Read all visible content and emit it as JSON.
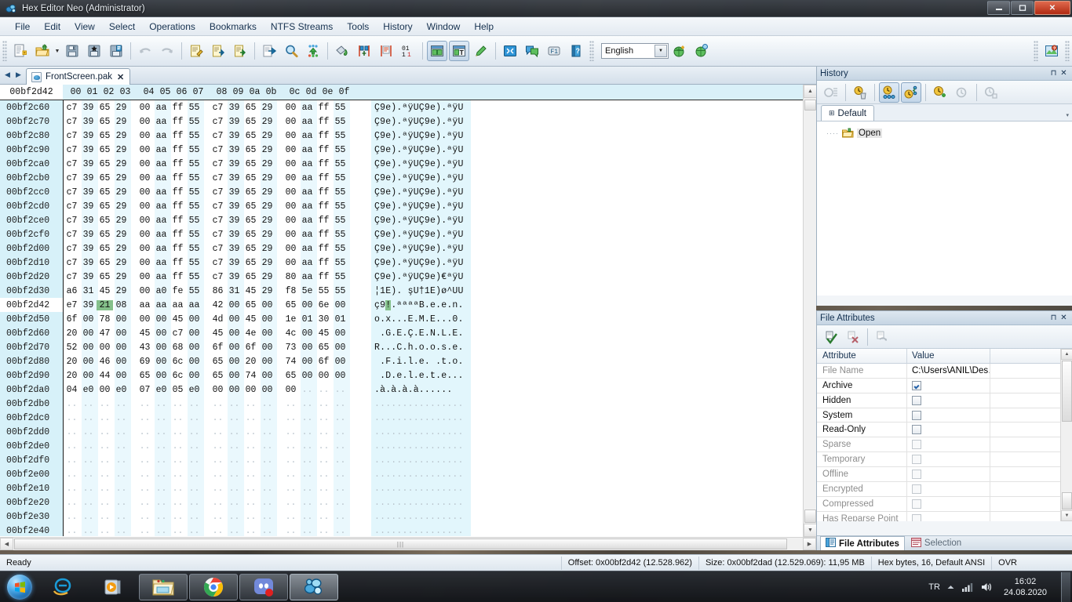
{
  "window": {
    "title": "Hex Editor Neo (Administrator)",
    "icon": "app-icon",
    "buttons": {
      "minimize": "—",
      "maximize": "❐",
      "close": "✕"
    }
  },
  "menubar": {
    "items": [
      {
        "label": "File"
      },
      {
        "label": "Edit"
      },
      {
        "label": "View"
      },
      {
        "label": "Select"
      },
      {
        "label": "Operations"
      },
      {
        "label": "Bookmarks"
      },
      {
        "label": "NTFS Streams"
      },
      {
        "label": "Tools"
      },
      {
        "label": "History"
      },
      {
        "label": "Window"
      },
      {
        "label": "Help"
      }
    ]
  },
  "toolbar": {
    "language_value": "English",
    "buttons": [
      {
        "name": "new-document-button",
        "icon": "new-file-icon"
      },
      {
        "name": "open-file-button",
        "icon": "open-folder-icon"
      },
      {
        "name": "open-dropdown-button",
        "icon": "chevron-down-icon"
      },
      {
        "name": "save-button",
        "icon": "save-disk-icon"
      },
      {
        "name": "save-as-button",
        "icon": "save-as-icon"
      },
      {
        "name": "save-all-button",
        "icon": "save-all-icon"
      },
      {
        "name": "undo-button",
        "icon": "undo-arrow-icon"
      },
      {
        "name": "redo-button",
        "icon": "redo-arrow-icon"
      },
      {
        "name": "cut-button",
        "icon": "cut-clipboard-icon"
      },
      {
        "name": "copy-button",
        "icon": "copy-clipboard-icon"
      },
      {
        "name": "paste-button",
        "icon": "paste-clipboard-icon"
      },
      {
        "name": "goto-button",
        "icon": "goto-arrow-icon"
      },
      {
        "name": "find-button",
        "icon": "magnifier-icon"
      },
      {
        "name": "find-all-button",
        "icon": "find-all-icon"
      },
      {
        "name": "fill-button",
        "icon": "fill-bucket-icon"
      },
      {
        "name": "insert-bytes-button",
        "icon": "insert-bytes-icon"
      },
      {
        "name": "delete-bytes-button",
        "icon": "delete-bytes-icon"
      },
      {
        "name": "binary-mode-button",
        "icon": "binary-0101-icon"
      },
      {
        "name": "pane-layout-button",
        "icon": "pane-layout-icon"
      },
      {
        "name": "text-pane-button",
        "icon": "text-pane-icon"
      },
      {
        "name": "edit-mode-button",
        "icon": "pencil-edit-icon"
      },
      {
        "name": "fullscreen-button",
        "icon": "fullscreen-icon"
      },
      {
        "name": "comments-button",
        "icon": "comment-balloon-icon"
      },
      {
        "name": "f1-help-button",
        "icon": "f1-key-icon"
      },
      {
        "name": "manual-button",
        "icon": "book-help-icon"
      },
      {
        "name": "add-language-button",
        "icon": "globe-add-icon"
      },
      {
        "name": "download-language-button",
        "icon": "globe-download-icon"
      },
      {
        "name": "help-topics-button",
        "icon": "help-image-icon"
      }
    ]
  },
  "tabs": {
    "nav_prev": "◀",
    "nav_next": "▶",
    "items": [
      {
        "label": "FrontScreen.pak",
        "close": "✕",
        "active": true
      }
    ]
  },
  "hex_view": {
    "cursor_offset_label": "00bf2d42",
    "column_headers": [
      "00",
      "01",
      "02",
      "03",
      "04",
      "05",
      "06",
      "07",
      "08",
      "09",
      "0a",
      "0b",
      "0c",
      "0d",
      "0e",
      "0f"
    ],
    "rows": [
      {
        "offset": "00bf2c60",
        "bytes": [
          "c7",
          "39",
          "65",
          "29",
          "00",
          "aa",
          "ff",
          "55",
          "c7",
          "39",
          "65",
          "29",
          "00",
          "aa",
          "ff",
          "55"
        ],
        "ascii": "Ç9e).ªÿUÇ9e).ªÿU"
      },
      {
        "offset": "00bf2c70",
        "bytes": [
          "c7",
          "39",
          "65",
          "29",
          "00",
          "aa",
          "ff",
          "55",
          "c7",
          "39",
          "65",
          "29",
          "00",
          "aa",
          "ff",
          "55"
        ],
        "ascii": "Ç9e).ªÿUÇ9e).ªÿU"
      },
      {
        "offset": "00bf2c80",
        "bytes": [
          "c7",
          "39",
          "65",
          "29",
          "00",
          "aa",
          "ff",
          "55",
          "c7",
          "39",
          "65",
          "29",
          "00",
          "aa",
          "ff",
          "55"
        ],
        "ascii": "Ç9e).ªÿUÇ9e).ªÿU"
      },
      {
        "offset": "00bf2c90",
        "bytes": [
          "c7",
          "39",
          "65",
          "29",
          "00",
          "aa",
          "ff",
          "55",
          "c7",
          "39",
          "65",
          "29",
          "00",
          "aa",
          "ff",
          "55"
        ],
        "ascii": "Ç9e).ªÿUÇ9e).ªÿU"
      },
      {
        "offset": "00bf2ca0",
        "bytes": [
          "c7",
          "39",
          "65",
          "29",
          "00",
          "aa",
          "ff",
          "55",
          "c7",
          "39",
          "65",
          "29",
          "00",
          "aa",
          "ff",
          "55"
        ],
        "ascii": "Ç9e).ªÿUÇ9e).ªÿU"
      },
      {
        "offset": "00bf2cb0",
        "bytes": [
          "c7",
          "39",
          "65",
          "29",
          "00",
          "aa",
          "ff",
          "55",
          "c7",
          "39",
          "65",
          "29",
          "00",
          "aa",
          "ff",
          "55"
        ],
        "ascii": "Ç9e).ªÿUÇ9e).ªÿU"
      },
      {
        "offset": "00bf2cc0",
        "bytes": [
          "c7",
          "39",
          "65",
          "29",
          "00",
          "aa",
          "ff",
          "55",
          "c7",
          "39",
          "65",
          "29",
          "00",
          "aa",
          "ff",
          "55"
        ],
        "ascii": "Ç9e).ªÿUÇ9e).ªÿU"
      },
      {
        "offset": "00bf2cd0",
        "bytes": [
          "c7",
          "39",
          "65",
          "29",
          "00",
          "aa",
          "ff",
          "55",
          "c7",
          "39",
          "65",
          "29",
          "00",
          "aa",
          "ff",
          "55"
        ],
        "ascii": "Ç9e).ªÿUÇ9e).ªÿU"
      },
      {
        "offset": "00bf2ce0",
        "bytes": [
          "c7",
          "39",
          "65",
          "29",
          "00",
          "aa",
          "ff",
          "55",
          "c7",
          "39",
          "65",
          "29",
          "00",
          "aa",
          "ff",
          "55"
        ],
        "ascii": "Ç9e).ªÿUÇ9e).ªÿU"
      },
      {
        "offset": "00bf2cf0",
        "bytes": [
          "c7",
          "39",
          "65",
          "29",
          "00",
          "aa",
          "ff",
          "55",
          "c7",
          "39",
          "65",
          "29",
          "00",
          "aa",
          "ff",
          "55"
        ],
        "ascii": "Ç9e).ªÿUÇ9e).ªÿU"
      },
      {
        "offset": "00bf2d00",
        "bytes": [
          "c7",
          "39",
          "65",
          "29",
          "00",
          "aa",
          "ff",
          "55",
          "c7",
          "39",
          "65",
          "29",
          "00",
          "aa",
          "ff",
          "55"
        ],
        "ascii": "Ç9e).ªÿUÇ9e).ªÿU"
      },
      {
        "offset": "00bf2d10",
        "bytes": [
          "c7",
          "39",
          "65",
          "29",
          "00",
          "aa",
          "ff",
          "55",
          "c7",
          "39",
          "65",
          "29",
          "00",
          "aa",
          "ff",
          "55"
        ],
        "ascii": "Ç9e).ªÿUÇ9e).ªÿU"
      },
      {
        "offset": "00bf2d20",
        "bytes": [
          "c7",
          "39",
          "65",
          "29",
          "00",
          "aa",
          "ff",
          "55",
          "c7",
          "39",
          "65",
          "29",
          "80",
          "aa",
          "ff",
          "55"
        ],
        "ascii": "Ç9e).ªÿUÇ9e)€ªÿU"
      },
      {
        "offset": "00bf2d30",
        "bytes": [
          "a6",
          "31",
          "45",
          "29",
          "00",
          "a0",
          "fe",
          "55",
          "86",
          "31",
          "45",
          "29",
          "f8",
          "5e",
          "55",
          "55"
        ],
        "ascii": "¦1E). şU†1E)ø^UU"
      },
      {
        "offset": "00bf2d42",
        "bytes": [
          "e7",
          "39",
          "21",
          "08",
          "aa",
          "aa",
          "aa",
          "aa",
          "42",
          "00",
          "65",
          "00",
          "65",
          "00",
          "6e",
          "00"
        ],
        "ascii": "ç9!.ªªªªB.e.e.n.",
        "cursor": true,
        "selected_byte_index": 2,
        "ascii_selected_index": 2
      },
      {
        "offset": "00bf2d50",
        "bytes": [
          "6f",
          "00",
          "78",
          "00",
          "00",
          "00",
          "45",
          "00",
          "4d",
          "00",
          "45",
          "00",
          "1e",
          "01",
          "30",
          "01"
        ],
        "ascii": "o.x...E.M.E...0."
      },
      {
        "offset": "00bf2d60",
        "bytes": [
          "20",
          "00",
          "47",
          "00",
          "45",
          "00",
          "c7",
          "00",
          "45",
          "00",
          "4e",
          "00",
          "4c",
          "00",
          "45",
          "00"
        ],
        "ascii": " .G.E.Ç.E.N.L.E."
      },
      {
        "offset": "00bf2d70",
        "bytes": [
          "52",
          "00",
          "00",
          "00",
          "43",
          "00",
          "68",
          "00",
          "6f",
          "00",
          "6f",
          "00",
          "73",
          "00",
          "65",
          "00"
        ],
        "ascii": "R...C.h.o.o.s.e."
      },
      {
        "offset": "00bf2d80",
        "bytes": [
          "20",
          "00",
          "46",
          "00",
          "69",
          "00",
          "6c",
          "00",
          "65",
          "00",
          "20",
          "00",
          "74",
          "00",
          "6f",
          "00"
        ],
        "ascii": " .F.i.l.e. .t.o."
      },
      {
        "offset": "00bf2d90",
        "bytes": [
          "20",
          "00",
          "44",
          "00",
          "65",
          "00",
          "6c",
          "00",
          "65",
          "00",
          "74",
          "00",
          "65",
          "00",
          "00",
          "00"
        ],
        "ascii": " .D.e.l.e.t.e..."
      },
      {
        "offset": "00bf2da0",
        "bytes": [
          "04",
          "e0",
          "00",
          "e0",
          "07",
          "e0",
          "05",
          "e0",
          "00",
          "00",
          "00",
          "00",
          "00",
          "..",
          "..",
          ".."
        ],
        "ascii": ".à.à.à.à......",
        "partial": true
      },
      {
        "offset": "00bf2db0",
        "bytes": [
          "..",
          "..",
          "..",
          "..",
          "..",
          "..",
          "..",
          "..",
          "..",
          "..",
          "..",
          "..",
          "..",
          "..",
          "..",
          ".."
        ],
        "ascii": "................",
        "empty": true
      },
      {
        "offset": "00bf2dc0",
        "bytes": [
          "..",
          "..",
          "..",
          "..",
          "..",
          "..",
          "..",
          "..",
          "..",
          "..",
          "..",
          "..",
          "..",
          "..",
          "..",
          ".."
        ],
        "ascii": "................",
        "empty": true
      },
      {
        "offset": "00bf2dd0",
        "bytes": [
          "..",
          "..",
          "..",
          "..",
          "..",
          "..",
          "..",
          "..",
          "..",
          "..",
          "..",
          "..",
          "..",
          "..",
          "..",
          ".."
        ],
        "ascii": "................",
        "empty": true
      },
      {
        "offset": "00bf2de0",
        "bytes": [
          "..",
          "..",
          "..",
          "..",
          "..",
          "..",
          "..",
          "..",
          "..",
          "..",
          "..",
          "..",
          "..",
          "..",
          "..",
          ".."
        ],
        "ascii": "................",
        "empty": true
      },
      {
        "offset": "00bf2df0",
        "bytes": [
          "..",
          "..",
          "..",
          "..",
          "..",
          "..",
          "..",
          "..",
          "..",
          "..",
          "..",
          "..",
          "..",
          "..",
          "..",
          ".."
        ],
        "ascii": "................",
        "empty": true
      },
      {
        "offset": "00bf2e00",
        "bytes": [
          "..",
          "..",
          "..",
          "..",
          "..",
          "..",
          "..",
          "..",
          "..",
          "..",
          "..",
          "..",
          "..",
          "..",
          "..",
          ".."
        ],
        "ascii": "................",
        "empty": true
      },
      {
        "offset": "00bf2e10",
        "bytes": [
          "..",
          "..",
          "..",
          "..",
          "..",
          "..",
          "..",
          "..",
          "..",
          "..",
          "..",
          "..",
          "..",
          "..",
          "..",
          ".."
        ],
        "ascii": "................",
        "empty": true
      },
      {
        "offset": "00bf2e20",
        "bytes": [
          "..",
          "..",
          "..",
          "..",
          "..",
          "..",
          "..",
          "..",
          "..",
          "..",
          "..",
          "..",
          "..",
          "..",
          "..",
          ".."
        ],
        "ascii": "................",
        "empty": true
      },
      {
        "offset": "00bf2e30",
        "bytes": [
          "..",
          "..",
          "..",
          "..",
          "..",
          "..",
          "..",
          "..",
          "..",
          "..",
          "..",
          "..",
          "..",
          "..",
          "..",
          ".."
        ],
        "ascii": "................",
        "empty": true
      },
      {
        "offset": "00bf2e40",
        "bytes": [
          "..",
          "..",
          "..",
          "..",
          "..",
          "..",
          "..",
          "..",
          "..",
          "..",
          "..",
          "..",
          "..",
          "..",
          "..",
          ".."
        ],
        "ascii": "................",
        "empty": true
      }
    ]
  },
  "history_panel": {
    "title": "History",
    "pin": "⊓",
    "close": "✕",
    "toolbar": [
      {
        "name": "history-list-button",
        "icon": "history-list-icon"
      },
      {
        "name": "clear-history-button",
        "icon": "clear-history-icon"
      },
      {
        "name": "history-branches-button",
        "icon": "history-branches-icon"
      },
      {
        "name": "history-tree-button",
        "icon": "history-tree-icon"
      },
      {
        "name": "add-history-button",
        "icon": "history-add-icon"
      },
      {
        "name": "remove-history-button",
        "icon": "history-remove-icon"
      },
      {
        "name": "export-history-button",
        "icon": "history-export-icon"
      }
    ],
    "tab_label": "Default",
    "tab_pin": "⊞",
    "dropdown": "▾",
    "tree_items": [
      {
        "label": "Open",
        "icon": "open-folder-icon",
        "prefix": "····"
      }
    ]
  },
  "file_attributes_panel": {
    "title": "File Attributes",
    "pin": "⊓",
    "close": "✕",
    "toolbar": [
      {
        "name": "apply-attributes-button",
        "icon": "apply-check-icon"
      },
      {
        "name": "reset-attributes-button",
        "icon": "reset-cross-icon"
      },
      {
        "name": "refresh-attributes-button",
        "icon": "refresh-attributes-icon"
      }
    ],
    "columns": [
      "Attribute",
      "Value"
    ],
    "rows": [
      {
        "attribute": "File Name",
        "type": "text",
        "value": "C:\\Users\\ANIL\\Des…",
        "enabled": false
      },
      {
        "attribute": "Archive",
        "type": "checkbox",
        "checked": true,
        "enabled": true
      },
      {
        "attribute": "Hidden",
        "type": "checkbox",
        "checked": false,
        "enabled": true
      },
      {
        "attribute": "System",
        "type": "checkbox",
        "checked": false,
        "enabled": true
      },
      {
        "attribute": "Read-Only",
        "type": "checkbox",
        "checked": false,
        "enabled": true
      },
      {
        "attribute": "Sparse",
        "type": "checkbox",
        "checked": false,
        "enabled": false
      },
      {
        "attribute": "Temporary",
        "type": "checkbox",
        "checked": false,
        "enabled": false
      },
      {
        "attribute": "Offline",
        "type": "checkbox",
        "checked": false,
        "enabled": false
      },
      {
        "attribute": "Encrypted",
        "type": "checkbox",
        "checked": false,
        "enabled": false
      },
      {
        "attribute": "Compressed",
        "type": "checkbox",
        "checked": false,
        "enabled": false
      },
      {
        "attribute": "Has Reparse Point",
        "type": "checkbox",
        "checked": false,
        "enabled": false
      }
    ],
    "bottom_tabs": [
      {
        "label": "File Attributes",
        "icon": "file-attributes-icon",
        "active": true
      },
      {
        "label": "Selection",
        "icon": "selection-icon",
        "active": false
      }
    ]
  },
  "statusbar": {
    "ready": "Ready",
    "offset": "Offset: 0x00bf2d42 (12.528.962)",
    "size": "Size: 0x00bf2dad (12.529.069): 11,95 MB",
    "mode": "Hex bytes, 16, Default ANSI",
    "insert": "OVR"
  },
  "taskbar": {
    "start": "start-orb",
    "items": [
      {
        "name": "taskbar-ie",
        "icon": "internet-explorer-icon",
        "state": "pinned"
      },
      {
        "name": "taskbar-media-player",
        "icon": "windows-media-player-icon",
        "state": "pinned"
      },
      {
        "name": "taskbar-explorer",
        "icon": "file-explorer-icon",
        "state": "open"
      },
      {
        "name": "taskbar-chrome",
        "icon": "google-chrome-icon",
        "state": "open"
      },
      {
        "name": "taskbar-discord",
        "icon": "discord-icon",
        "state": "open"
      },
      {
        "name": "taskbar-hexeditor",
        "icon": "hex-editor-neo-icon",
        "state": "active"
      }
    ],
    "tray": {
      "language": "TR",
      "show_hidden": "▲",
      "network": "network-icon",
      "volume": "volume-icon",
      "time": "16:02",
      "date": "24.08.2020"
    }
  },
  "colors": {
    "hex_offset_bg": "#d7f1f9",
    "hex_ascii_bg": "#e2f6fc",
    "selection_green": "#84c08a",
    "accent_blue": "#1f6fa8"
  }
}
